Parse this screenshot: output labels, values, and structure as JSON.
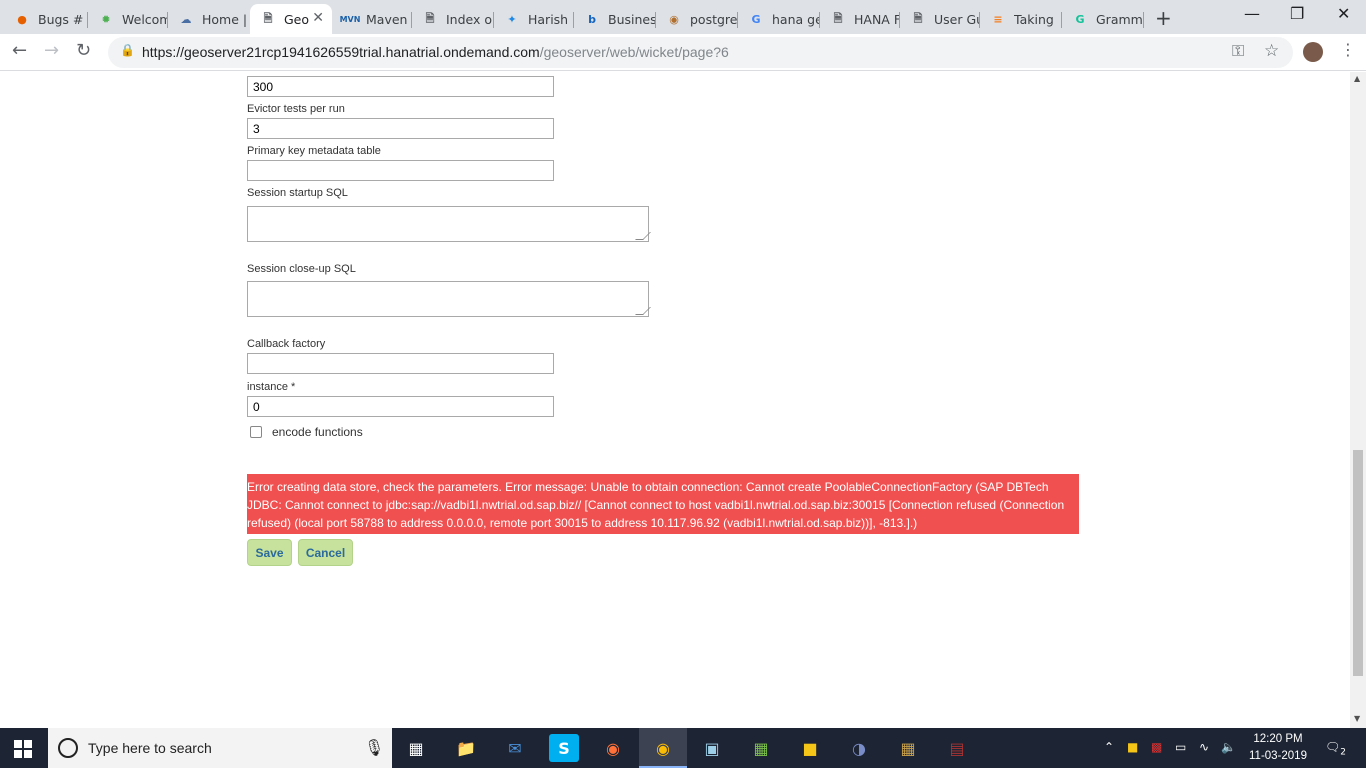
{
  "tabs": [
    {
      "label": "Bugs #",
      "icon": "firefox-bug-icon"
    },
    {
      "label": "Welcom",
      "icon": "gear-green-icon"
    },
    {
      "label": "Home |",
      "icon": "cloud-icon"
    },
    {
      "label": "Geo",
      "icon": "page-icon",
      "active": true
    },
    {
      "label": "Maven",
      "icon": "mvn-icon"
    },
    {
      "label": "Index o",
      "icon": "page-icon"
    },
    {
      "label": "Harish",
      "icon": "feather-icon"
    },
    {
      "label": "Busines",
      "icon": "b-icon"
    },
    {
      "label": "postgre",
      "icon": "coin-icon"
    },
    {
      "label": "hana ge",
      "icon": "google-icon"
    },
    {
      "label": "HANA F",
      "icon": "page-icon"
    },
    {
      "label": "User Gu",
      "icon": "page-icon"
    },
    {
      "label": "Taking",
      "icon": "stack-icon"
    },
    {
      "label": "Gramm",
      "icon": "grammarly-icon"
    }
  ],
  "url": {
    "host": "https://geoserver21rcp1941626559trial.hanatrial.ondemand.com",
    "path": "/geoserver/web/wicket/page?6"
  },
  "form": {
    "field_top_value": "300",
    "evictor_label": "Evictor tests per run",
    "evictor_value": "3",
    "pk_label": "Primary key metadata table",
    "pk_value": "",
    "startup_label": "Session startup SQL",
    "closeup_label": "Session close-up SQL",
    "callback_label": "Callback factory",
    "callback_value": "",
    "instance_label": "instance *",
    "instance_value": "0",
    "encode_label": "encode functions"
  },
  "error": {
    "line1": "Error creating data store, check the parameters. Error message: Unable to obtain connection: Cannot create PoolableConnectionFactory (SAP DBTech",
    "line2": "JDBC: Cannot connect to jdbc:sap://vadbi1l.nwtrial.od.sap.biz// [Cannot connect to host vadbi1l.nwtrial.od.sap.biz:30015 [Connection refused (Connection",
    "line3": "refused) (local port 58788 to address 0.0.0.0, remote port 30015 to address 10.117.96.92 (vadbi1l.nwtrial.od.sap.biz))], -813.].)"
  },
  "buttons": {
    "save": "Save",
    "cancel": "Cancel"
  },
  "taskbar": {
    "search_placeholder": "Type here to search",
    "time": "12:20 PM",
    "date": "11-03-2019",
    "notification_count": "2"
  },
  "colors": {
    "error_bg": "#f05050",
    "button_bg": "#c6e29c",
    "button_text": "#2b6a9b"
  }
}
